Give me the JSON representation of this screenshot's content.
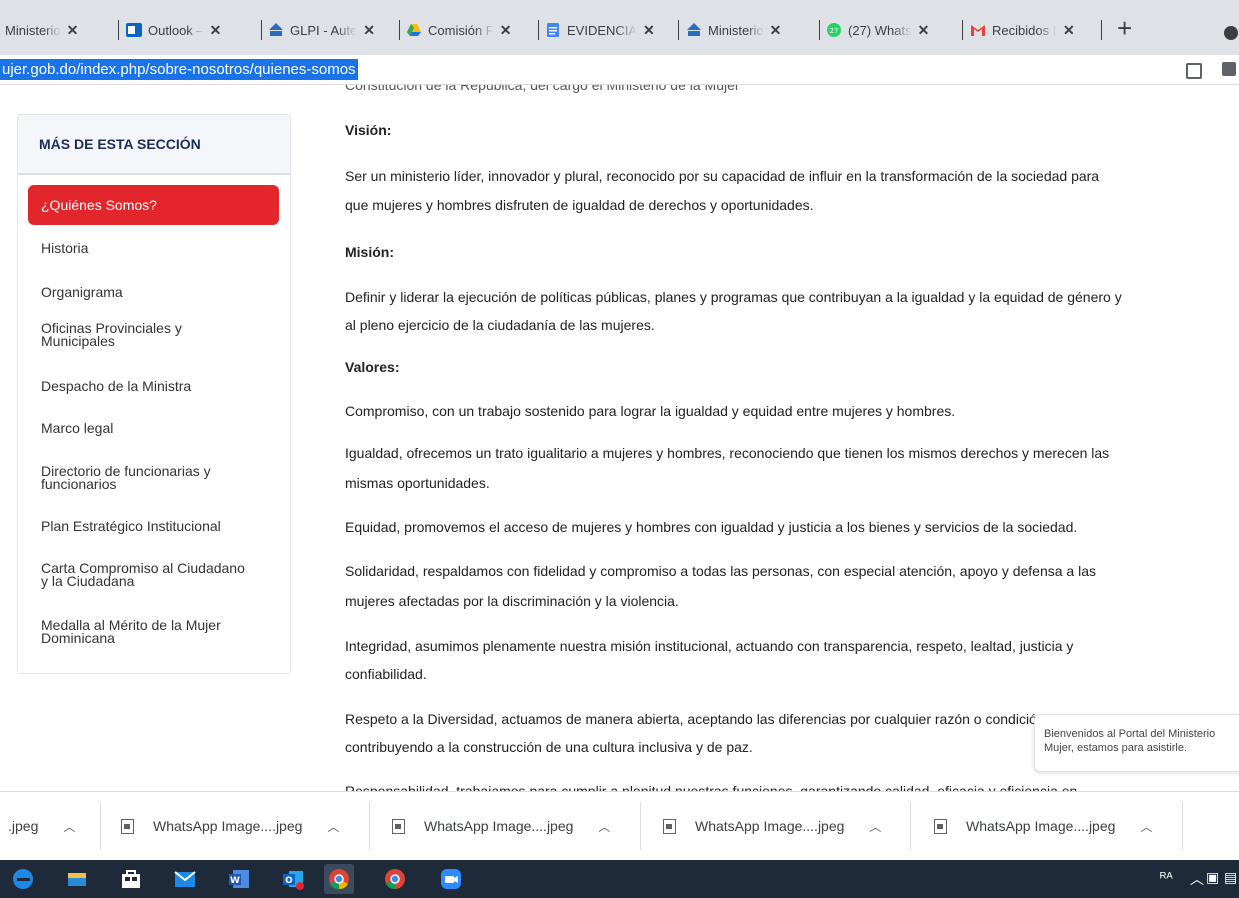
{
  "browser": {
    "tabs": [
      {
        "title": "Ministerio",
        "icon": "page-icon"
      },
      {
        "title": "Outlook – ",
        "icon": "outlook-icon"
      },
      {
        "title": "GLPI - Aute",
        "icon": "gov-shield-icon"
      },
      {
        "title": "Comisión F",
        "icon": "google-drive-icon"
      },
      {
        "title": "EVIDENCIA",
        "icon": "google-docs-icon"
      },
      {
        "title": "Ministerio ",
        "icon": "gov-shield-icon"
      },
      {
        "title": "(27) Whats",
        "icon": "whatsapp-icon"
      },
      {
        "title": "Recibidos (",
        "icon": "gmail-icon"
      }
    ],
    "url": "ujer.gob.do/index.php/sobre-nosotros/quienes-somos"
  },
  "sidebar": {
    "title": "MÁS DE ESTA SECCIÓN",
    "active_item": "¿Quiénes Somos?",
    "items": [
      "Historia",
      "Organigrama",
      "Oficinas Provinciales y\nMunicipales",
      "Despacho de la Ministra",
      "Marco legal",
      "Directorio de funcionarias y\nfuncionarios",
      "Plan Estratégico Institucional",
      "Carta Compromiso al Ciudadano\ny la Ciudadana",
      "Medalla al Mérito de la Mujer\nDominicana"
    ]
  },
  "content": {
    "cut_top": "Constitución de la República, del cargo el Ministerio de la Mujer",
    "vision_heading": "Visión:",
    "vision_lines": [
      "Ser un ministerio líder, innovador y plural, reconocido por su capacidad de influir en la transformación de la sociedad para",
      "que mujeres y hombres disfruten de igualdad de derechos y oportunidades."
    ],
    "mision_heading": "Misión:",
    "mision_lines": [
      "Definir y liderar la ejecución de políticas públicas, planes y programas que contribuyan a la igualdad y la equidad de género y",
      "al pleno ejercicio de la ciudadanía de las mujeres."
    ],
    "valores_heading": "Valores:",
    "valores_lines": [
      "Compromiso, con un trabajo sostenido para lograr la igualdad y equidad entre mujeres y hombres.",
      "Igualdad, ofrecemos un trato igualitario a mujeres y hombres, reconociendo que tienen los mismos derechos y merecen las",
      "mismas oportunidades.",
      "Equidad, promovemos el acceso de  mujeres y hombres con igualdad y justicia a los bienes y servicios de la sociedad.",
      "Solidaridad, respaldamos con fidelidad y compromiso a todas las personas, con especial  atención, apoyo y defensa a las",
      "mujeres afectadas por la discriminación  y la violencia.",
      "Integridad, asumimos plenamente nuestra misión  institucional, actuando con transparencia, respeto, lealtad, justicia y",
      "confiabilidad.",
      "Respeto a la Diversidad, actuamos de manera abierta, aceptando las diferencias por cualquier razón o condición",
      "contribuyendo a la construcción de una cultura inclusiva y de paz.",
      "Responsabilidad, trabajamos para cumplir a plenitud  nuestras funciones, garantizando  calidad, eficacia y eficiencia en"
    ]
  },
  "chat_tooltip": {
    "line1": "Bienvenidos al Portal del Ministerio",
    "line2": "Mujer, estamos para asistirle."
  },
  "downloads": [
    {
      "name": ".jpeg"
    },
    {
      "name": "WhatsApp Image....jpeg"
    },
    {
      "name": "WhatsApp Image....jpeg"
    },
    {
      "name": "WhatsApp Image....jpeg"
    },
    {
      "name": "WhatsApp Image....jpeg"
    }
  ],
  "taskbar": {
    "apps": [
      "edge-icon",
      "file-explorer-icon",
      "store-icon",
      "mail-icon",
      "word-icon",
      "outlook-icon",
      "chrome-icon",
      "chrome-profile-icon",
      "zoom-icon"
    ]
  },
  "colors": {
    "accent_red": "#e3262b",
    "heading_navy": "#1b2c5c",
    "url_highlight": "#1a73e8"
  }
}
